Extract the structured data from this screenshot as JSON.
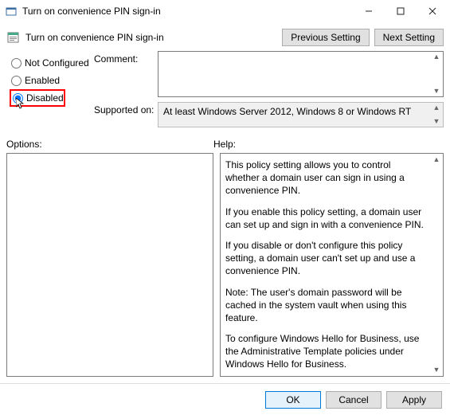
{
  "window": {
    "title": "Turn on convenience PIN sign-in"
  },
  "toolbar": {
    "title": "Turn on convenience PIN sign-in",
    "previous": "Previous Setting",
    "next": "Next Setting"
  },
  "radios": {
    "not_configured": "Not Configured",
    "enabled": "Enabled",
    "disabled": "Disabled",
    "selected": "disabled"
  },
  "fields": {
    "comment_label": "Comment:",
    "comment_value": "",
    "supported_label": "Supported on:",
    "supported_value": "At least Windows Server 2012, Windows 8 or Windows RT"
  },
  "panes": {
    "options_label": "Options:",
    "help_label": "Help:"
  },
  "help": {
    "p1": "This policy setting allows you to control whether a domain user can sign in using a convenience PIN.",
    "p2": "If you enable this policy setting, a domain user can set up and sign in with a convenience PIN.",
    "p3": "If you disable or don't configure this policy setting, a domain user can't set up and use a convenience PIN.",
    "p4": "Note: The user's domain password will be cached in the system vault when using this feature.",
    "p5": "To configure Windows Hello for Business, use the Administrative Template policies under Windows Hello for Business."
  },
  "footer": {
    "ok": "OK",
    "cancel": "Cancel",
    "apply": "Apply"
  }
}
